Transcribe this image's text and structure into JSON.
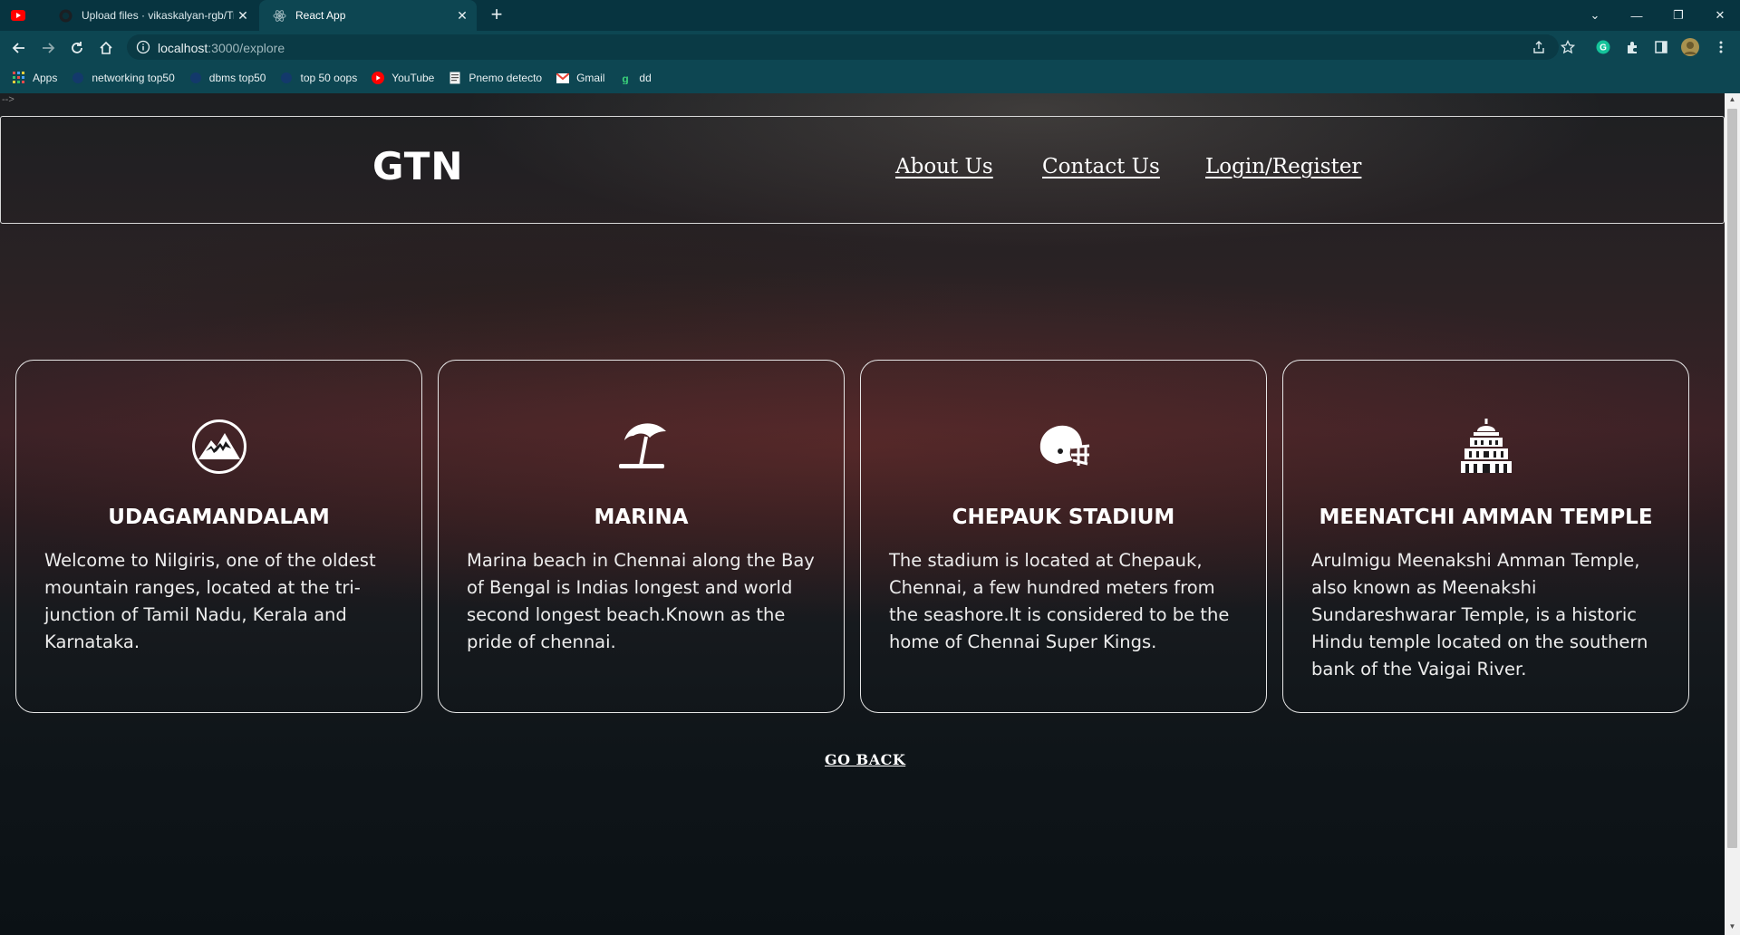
{
  "browser": {
    "tabs": [
      {
        "title": "Upload files · vikaskalyan-rgb/Tra",
        "icon": "github-icon"
      },
      {
        "title": "React App",
        "icon": "react-icon",
        "active": true
      }
    ],
    "url_host": "localhost",
    "url_path": ":3000/explore",
    "bookmarks": [
      {
        "label": "Apps",
        "icon": "apps-grid-icon"
      },
      {
        "label": "networking top50",
        "icon": "globe-icon"
      },
      {
        "label": "dbms top50",
        "icon": "globe-icon"
      },
      {
        "label": "top 50 oops",
        "icon": "globe-icon"
      },
      {
        "label": "YouTube",
        "icon": "youtube-icon"
      },
      {
        "label": "Pnemo detecto",
        "icon": "document-icon"
      },
      {
        "label": "Gmail",
        "icon": "gmail-icon"
      },
      {
        "label": "dd",
        "icon": "g-icon"
      }
    ]
  },
  "page": {
    "logo": "GTN",
    "nav": {
      "about": "About Us",
      "contact": "Contact Us",
      "login": "Login/Register"
    },
    "stray_text": "-->",
    "cards": [
      {
        "icon": "mountain-icon",
        "title": "UDAGAMANDALAM",
        "text": "Welcome to Nilgiris, one of the oldest mountain ranges, located at the tri-junction of Tamil Nadu, Kerala and Karnataka."
      },
      {
        "icon": "beach-umbrella-icon",
        "title": "MARINA",
        "text": "Marina beach in Chennai along the Bay of Bengal is Indias longest and world second longest beach.Known as the pride of chennai."
      },
      {
        "icon": "football-helmet-icon",
        "title": "CHEPAUK STADIUM",
        "text": "The stadium is located at Chepauk, Chennai, a few hundred meters from the seashore.It is considered to be the home of Chennai Super Kings."
      },
      {
        "icon": "temple-icon",
        "title": "MEENATCHI AMMAN TEMPLE",
        "text": "Arulmigu Meenakshi Amman Temple, also known as Meenakshi Sundareshwarar Temple, is a historic Hindu temple located on the southern bank of the Vaigai River."
      }
    ],
    "go_back": "GO BACK"
  }
}
